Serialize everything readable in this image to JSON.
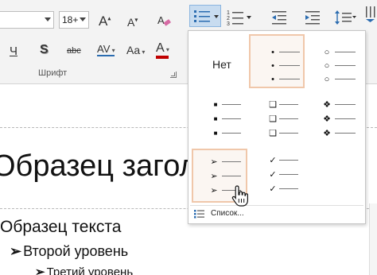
{
  "ribbon": {
    "font_size": "18+",
    "grow_font": "A",
    "shrink_font": "A",
    "underline": "Ч",
    "shadow": "S",
    "strikethrough": "abc",
    "spacing": "AV",
    "change_case": "Aa",
    "font_color": "A",
    "font_group_label": "Шрифт",
    "accent_color": "#c00000"
  },
  "slide": {
    "title": "Образец заголо",
    "level1": "Образец текста",
    "level2": "Второй уровень",
    "level3": "Третий уровень",
    "bullet_arrow": "➢"
  },
  "bullets_menu": {
    "none_label": "Нет",
    "styles": [
      {
        "name": "none",
        "symbol": ""
      },
      {
        "name": "filled-round",
        "symbol": "•"
      },
      {
        "name": "hollow-round",
        "symbol": "○"
      },
      {
        "name": "filled-square",
        "symbol": "■"
      },
      {
        "name": "hollow-square",
        "symbol": "❑"
      },
      {
        "name": "star",
        "symbol": "❖"
      },
      {
        "name": "arrow",
        "symbol": "➢"
      },
      {
        "name": "checkmark",
        "symbol": "✓"
      }
    ],
    "footer_label": "Список...",
    "highlight_color": "#f0c7aa"
  }
}
